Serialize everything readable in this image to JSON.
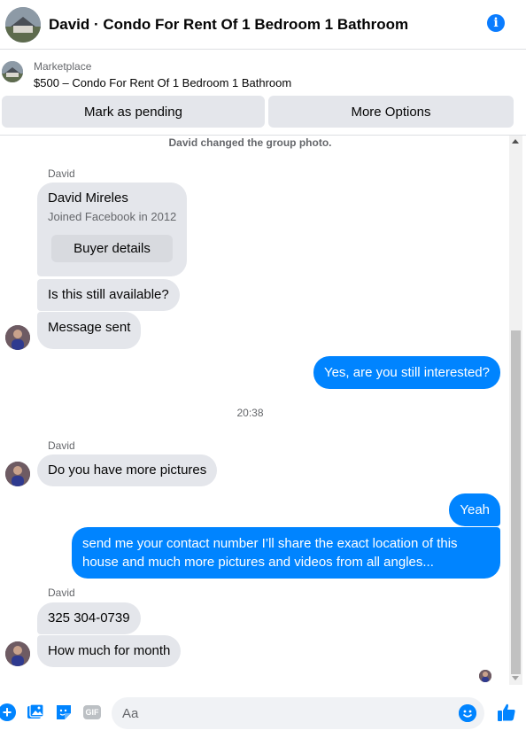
{
  "header": {
    "title": "David · Condo For Rent Of 1 Bedroom 1 Bathroom",
    "info_icon": "info-icon"
  },
  "marketplace": {
    "label": "Marketplace",
    "listing": "$500 – Condo For Rent Of 1 Bedroom 1 Bathroom",
    "mark_pending": "Mark as pending",
    "more_options": "More Options"
  },
  "chat": {
    "system_notice": "David changed the group photo.",
    "sender_name": "David",
    "profile_card": {
      "name": "David Mireles",
      "subtitle": "Joined Facebook in 2012",
      "button": "Buyer details"
    },
    "msg_available": "Is this still available?",
    "msg_sent": "Message sent",
    "out_interested": "Yes, are you still interested?",
    "timestamp": "20:38",
    "msg_pictures": "Do you have more pictures",
    "out_yeah": "Yeah",
    "out_contact": "send me your contact number I’ll share the exact location of this house and much more pictures and videos from all angles...",
    "msg_phone": "325 304-0739",
    "msg_month": "How much for month"
  },
  "composer": {
    "placeholder": "Aa",
    "gif_label": "GIF"
  },
  "colors": {
    "accent": "#0084ff",
    "incoming_bubble": "#e4e6eb",
    "secondary_text": "#65676b"
  }
}
